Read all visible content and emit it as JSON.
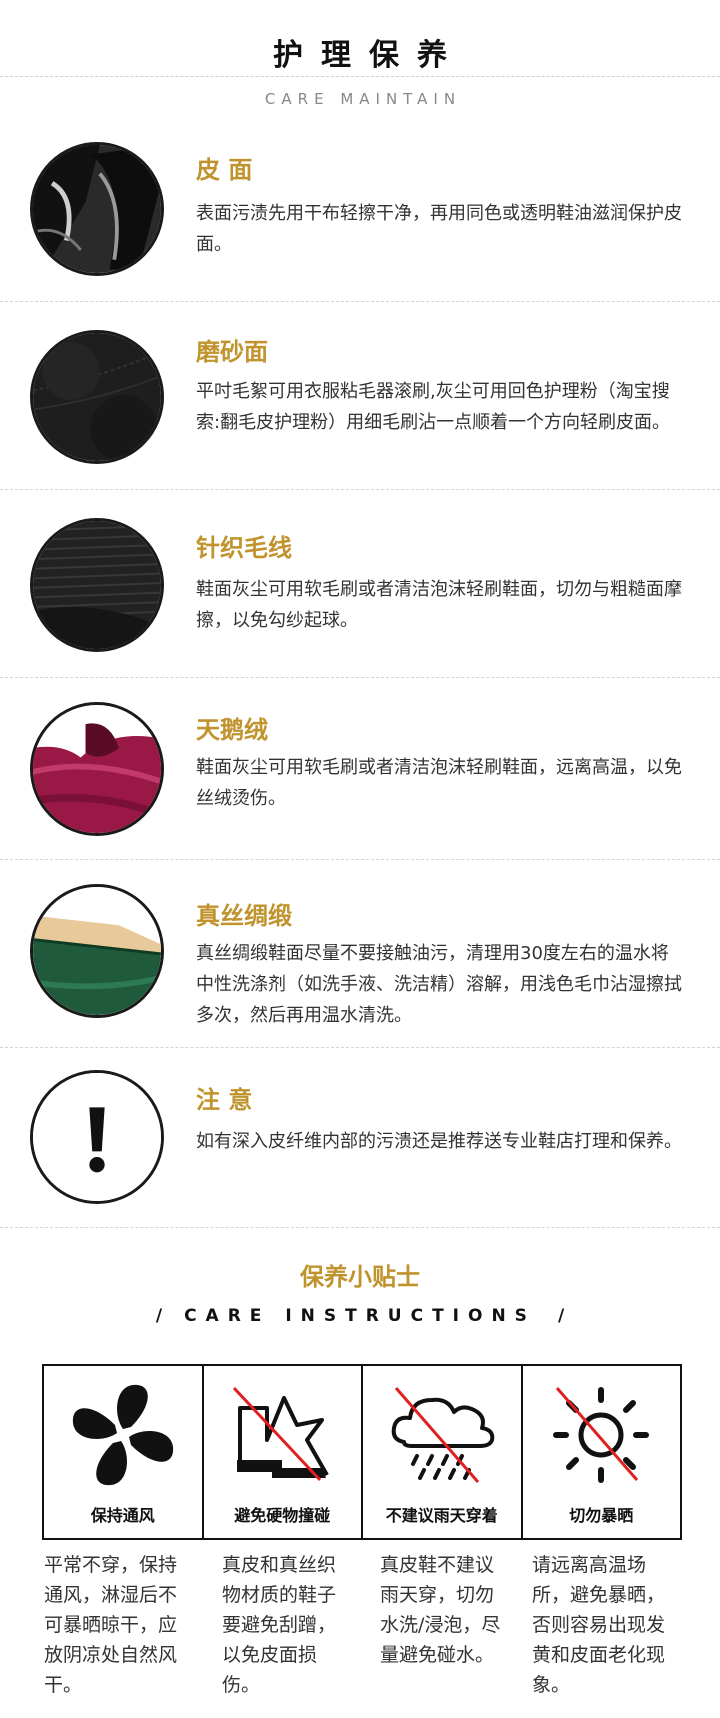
{
  "header": {
    "title": "护理保养",
    "subtitle": "CARE MAINTAIN"
  },
  "sections": [
    {
      "title": "皮 面",
      "body": "表面污渍先用干布轻擦干净，再用同色或透明鞋油滋润保护皮面。",
      "image": "black-leather-photo"
    },
    {
      "title": "磨砂面",
      "body": "平吋毛絮可用衣服粘毛器滚刷,灰尘可用回色护理粉（淘宝搜索:翻毛皮护理粉）用细毛刷沾一点顺着一个方向轻刷皮面。",
      "image": "black-suede-photo"
    },
    {
      "title": "针织毛线",
      "body": "鞋面灰尘可用软毛刷或者清洁泡沫轻刷鞋面，切勿与粗糙面摩擦，以免勾纱起球。",
      "image": "black-knit-photo"
    },
    {
      "title": "天鹅绒",
      "body": "鞋面灰尘可用软毛刷或者清洁泡沫轻刷鞋面，远离高温，以免丝绒烫伤。",
      "image": "burgundy-velvet-photo"
    },
    {
      "title": "真丝绸缎",
      "body": "真丝绸缎鞋面尽量不要接触油污，清理用30度左右的温水将中性洗涤剂（如洗手液、洗洁精）溶解，用浅色毛巾沾湿擦拭多次，然后再用温水清洗。",
      "image": "green-satin-photo"
    },
    {
      "title": "注 意",
      "body": "如有深入皮纤维内部的污溃还是推荐送专业鞋店打理和保养。",
      "image": "exclamation-icon"
    }
  ],
  "tips": {
    "title": "保养小贴士",
    "subtitle_left": "/",
    "subtitle_text": "CARE INSTRUCTIONS",
    "subtitle_right": "/",
    "items": [
      {
        "label": "保持通风",
        "icon": "fan-icon",
        "desc": "平常不穿，保持通风，淋湿后不可暴晒晾干，应放阴凉处自然风干。"
      },
      {
        "label": "避免硬物撞碰",
        "icon": "no-hard-objects-icon",
        "desc": "真皮和真丝织物材质的鞋子要避免刮蹭，以免皮面损伤。"
      },
      {
        "label": "不建议雨天穿着",
        "icon": "no-rain-icon",
        "desc": "真皮鞋不建议雨天穿，切勿水洗/浸泡，尽量避免碰水。"
      },
      {
        "label": "切勿暴晒",
        "icon": "no-sun-icon",
        "desc": "请远离高温场所，避免暴晒，否则容易出现发黄和皮面老化现象。"
      }
    ]
  },
  "colors": {
    "accent": "#c0932d",
    "prohibit": "#e02020",
    "text": "#333333"
  }
}
